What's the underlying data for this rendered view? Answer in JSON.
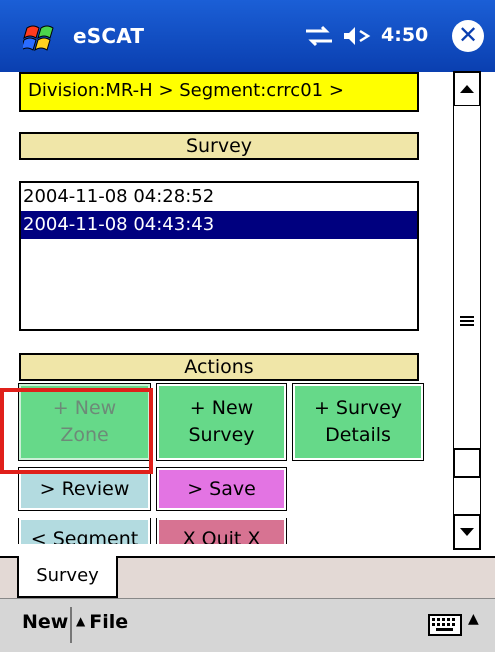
{
  "titlebar": {
    "app_title": "eSCAT",
    "clock": "4:50",
    "close_glyph": "✕",
    "icons": [
      "windows-start-icon",
      "sync-icon",
      "speaker-icon",
      "close-icon"
    ]
  },
  "path_bar": {
    "text": "Division:MR-H > Segment:crrc01 >"
  },
  "survey_section": {
    "header": "Survey",
    "items": [
      {
        "label": "2004-11-08 04:28:52",
        "selected": false
      },
      {
        "label": "2004-11-08 04:43:43",
        "selected": true
      }
    ]
  },
  "actions_section": {
    "header": "Actions",
    "buttons": {
      "new_zone": "+ New\nZone",
      "new_survey": "+ New\nSurvey",
      "survey_details": "+ Survey\nDetails",
      "review": "> Review",
      "save": "> Save",
      "segment": "< Segment",
      "quit": "X Quit X"
    }
  },
  "tabs": [
    {
      "label": "Survey"
    }
  ],
  "menubar": {
    "new_label": "New",
    "file_label": "File",
    "file_caret": "▲",
    "kbd_caret": "▲"
  },
  "colors": {
    "titlebar": "#1b5fd6",
    "path_bar_bg": "#ffff00",
    "section_header_bg": "#f0e6a8",
    "selection_bg": "#00007f",
    "green_button": "#66d989",
    "blue_button": "#b3dbe0",
    "pink_button": "#e374e3",
    "rose_button": "#d77392",
    "highlight": "#e0201a"
  }
}
